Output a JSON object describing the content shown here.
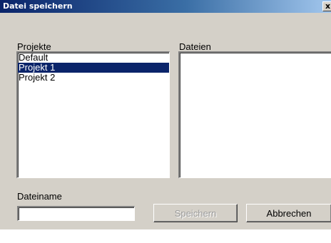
{
  "window": {
    "title": "Datei speichern",
    "close_label": "x"
  },
  "projects": {
    "label": "Projekte",
    "items": [
      "Default",
      "Projekt 1",
      "Projekt 2"
    ],
    "selected": "Projekt 1"
  },
  "files": {
    "label": "Dateien",
    "items": []
  },
  "filename": {
    "label": "Dateiname",
    "value": ""
  },
  "buttons": {
    "save_label": "Speichern",
    "save_enabled": false,
    "cancel_label": "Abbrechen"
  },
  "colors": {
    "window_bg": "#d4d0c8",
    "titlebar_start": "#0a246a",
    "titlebar_end": "#a6caf0",
    "selection_bg": "#0a246a"
  }
}
